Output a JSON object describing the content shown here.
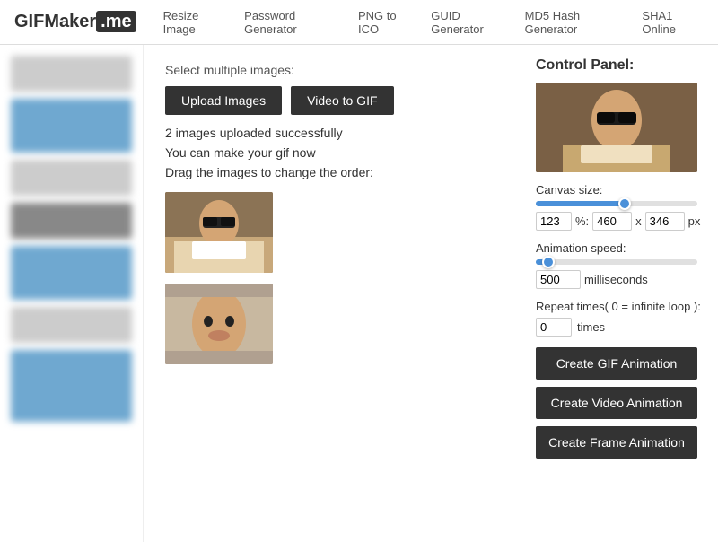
{
  "navbar": {
    "logo_text": "GIFMaker",
    "logo_highlight": ".me",
    "links": [
      {
        "label": "Resize Image"
      },
      {
        "label": "Password Generator"
      },
      {
        "label": "PNG to ICO"
      },
      {
        "label": "GUID Generator"
      },
      {
        "label": "MD5 Hash Generator"
      },
      {
        "label": "SHA1 Online"
      }
    ]
  },
  "main": {
    "select_label": "Select multiple images:",
    "upload_button": "Upload Images",
    "video_button": "Video to GIF",
    "success_msg": "2 images uploaded successfully",
    "info_msg": "You can make your gif now",
    "drag_msg": "Drag the images to change the order:"
  },
  "control_panel": {
    "title": "Control Panel:",
    "canvas_label": "Canvas size:",
    "canvas_pct": "123",
    "canvas_w": "460",
    "canvas_h": "346",
    "canvas_unit": "px",
    "speed_label": "Animation speed:",
    "speed_value": "500",
    "speed_unit": "milliseconds",
    "repeat_label": "Repeat times( 0 = infinite loop ):",
    "repeat_value": "0",
    "repeat_unit": "times",
    "btn_gif": "Create GIF Animation",
    "btn_video": "Create Video Animation",
    "btn_frame": "Create Frame Animation"
  }
}
